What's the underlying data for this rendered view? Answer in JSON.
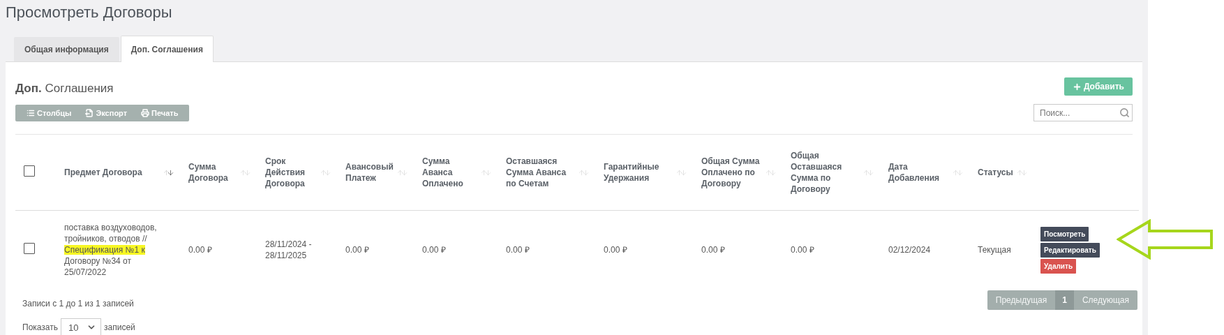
{
  "page_title": "Просмотреть Договоры",
  "tabs": [
    {
      "label": "Общая информация",
      "selected": false
    },
    {
      "label": "Доп. Соглашения",
      "selected": true
    }
  ],
  "section": {
    "title_bold": "Доп.",
    "title_rest": "Соглашения",
    "add_button": "Добавить"
  },
  "toolbar": [
    {
      "kind": "columns",
      "label": "Столбцы"
    },
    {
      "kind": "export",
      "label": "Экспорт"
    },
    {
      "kind": "print",
      "label": "Печать"
    }
  ],
  "search": {
    "placeholder": "Поиск..."
  },
  "table": {
    "select_all": {
      "checked": false
    },
    "columns": [
      {
        "label": "Предмет Договора",
        "sorted": true
      },
      {
        "label": "Сумма Договора",
        "sorted": false
      },
      {
        "label": "Срок Действия Договора",
        "sorted": false
      },
      {
        "label": "Авансовый Платеж",
        "sorted": false
      },
      {
        "label": "Сумма Аванса Оплачено",
        "sorted": false
      },
      {
        "label": "Оставшаяся Сумма Аванса по Счетам",
        "sorted": false
      },
      {
        "label": "Гарантийные Удержания",
        "sorted": false
      },
      {
        "label": "Общая Сумма Оплачено по Договору",
        "sorted": false
      },
      {
        "label": "Общая Оставшаяся Сумма по Договору",
        "sorted": false
      },
      {
        "label": "Дата Добавления",
        "sorted": false
      },
      {
        "label": "Статусы",
        "sorted": false
      }
    ],
    "rows": [
      {
        "checked": false,
        "cells": [
          {
            "parts": [
              {
                "text": "поставка воздуховодов, тройников, отводов // ",
                "highlighted": false
              },
              {
                "text": "Спецификация №1 к",
                "highlighted": true
              },
              {
                "text": " Договору №34 от 25/07/2022",
                "highlighted": false
              }
            ]
          },
          "0.00 ₽",
          "28/11/2024 - 28/11/2025",
          "0.00 ₽",
          "0.00 ₽",
          "0.00 ₽",
          "0.00 ₽",
          "0.00 ₽",
          "0.00 ₽",
          "02/12/2024",
          "Текущая"
        ],
        "actions": [
          {
            "kind": "view",
            "label": "Посмотреть"
          },
          {
            "kind": "edit",
            "label": "Редактировать"
          },
          {
            "kind": "delete",
            "label": "Удалить"
          }
        ],
        "pointed": true
      }
    ]
  },
  "info": "Записи с 1 до 1 из 1 записей",
  "pagination": [
    {
      "label": "Предыдущая",
      "selected": false
    },
    {
      "label": "1",
      "selected": true
    },
    {
      "label": "Следующая",
      "selected": false
    }
  ],
  "length": {
    "before": "Показать",
    "value": "10",
    "after": "записей"
  }
}
